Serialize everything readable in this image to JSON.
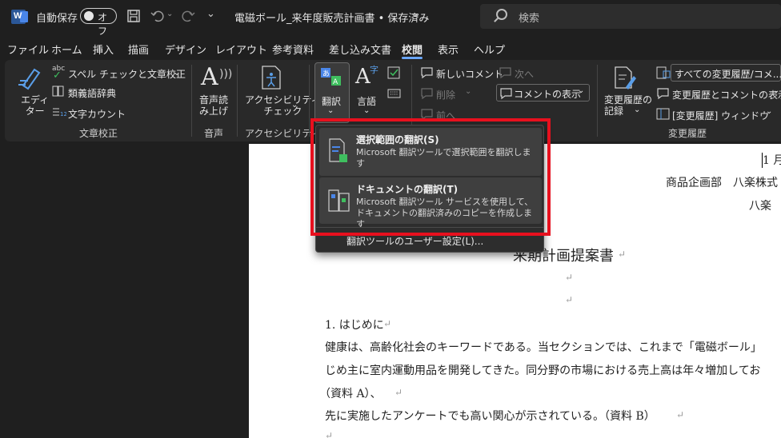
{
  "titlebar": {
    "autosave_label": "自動保存",
    "autosave_state": "オフ",
    "document_title": "電磁ボール_来年度販売計画書 • 保存済み",
    "search_placeholder": "検索"
  },
  "tabs": [
    "ファイル",
    "ホーム",
    "挿入",
    "描画",
    "デザイン",
    "レイアウト",
    "参考資料",
    "差し込み文書",
    "校閲",
    "表示",
    "ヘルプ"
  ],
  "active_tab": "校閲",
  "ribbon": {
    "editor": "エディ\nター",
    "spelling": "スペル チェックと文章校正",
    "thesaurus": "類義語辞典",
    "word_count": "文字カウント",
    "group_proofing": "文章校正",
    "read_aloud": "音声読\nみ上げ",
    "group_speech": "音声",
    "accessibility": "アクセシビリティ\nチェック",
    "group_accessibility": "アクセシビリティ",
    "translate": "翻訳",
    "language": "言語",
    "new_comment": "新しいコメント",
    "next": "次へ",
    "delete": "削除",
    "previous": "前へ",
    "show_comments": "コメントの表示",
    "track_changes": "変更履歴の\n記録",
    "all_markup": "すべての変更履歴/コメ...",
    "show_markup": "変更履歴とコメントの表示",
    "reviewing_pane": "[変更履歴] ウィンドウ",
    "group_tracking": "変更履歴"
  },
  "dropdown": {
    "item1_title": "選択範囲の翻訳(S)",
    "item1_desc": "Microsoft 翻訳ツールで選択範囲を翻訳します",
    "item2_title": "ドキュメントの翻訳(T)",
    "item2_desc": "Microsoft 翻訳ツール サービスを使用して、ドキュメントの翻訳済みのコピーを作成します",
    "footer": "翻訳ツールのユーザー設定(L)..."
  },
  "document": {
    "date_partial": "1 月",
    "dept": "商品企画部　八楽株式",
    "author": "八楽",
    "title": "来期計画提案書",
    "heading1": "1. はじめに",
    "para1": "健康は、高齢化社会のキーワードである。当セクションでは、これまで「電磁ボール」",
    "para2": "じめ主に室内運動用品を開発してきた。同分野の市場における売上高は年々増加してお",
    "para3": "（資料 A）、",
    "para4": "先に実施したアンケートでも高い関心が示されている。（資料 B）",
    "para_mark": "↵"
  }
}
